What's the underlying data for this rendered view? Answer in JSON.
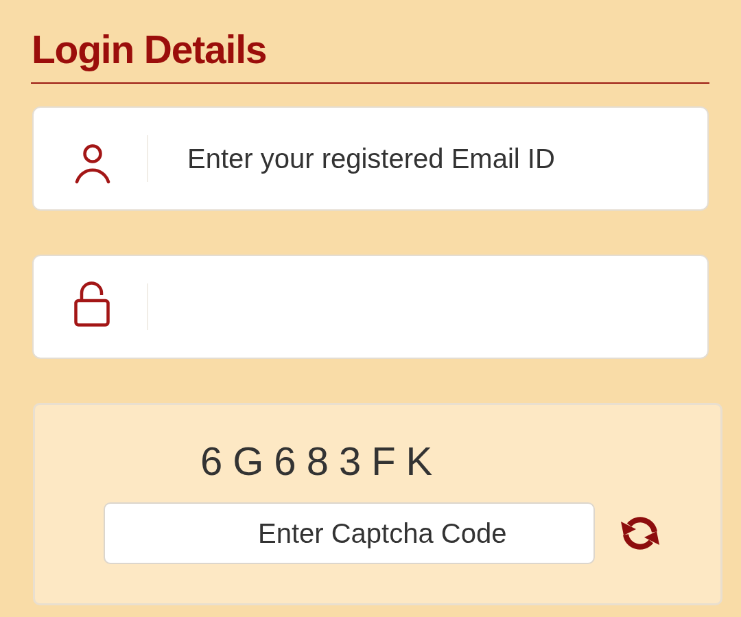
{
  "title": "Login Details",
  "fields": [
    {
      "kind": "email",
      "placeholder": "Enter your registered Email ID"
    },
    {
      "kind": "password"
    }
  ],
  "captcha": {
    "code": "6G683FK",
    "input": {
      "placeholder": "Enter Captcha Code"
    }
  }
}
